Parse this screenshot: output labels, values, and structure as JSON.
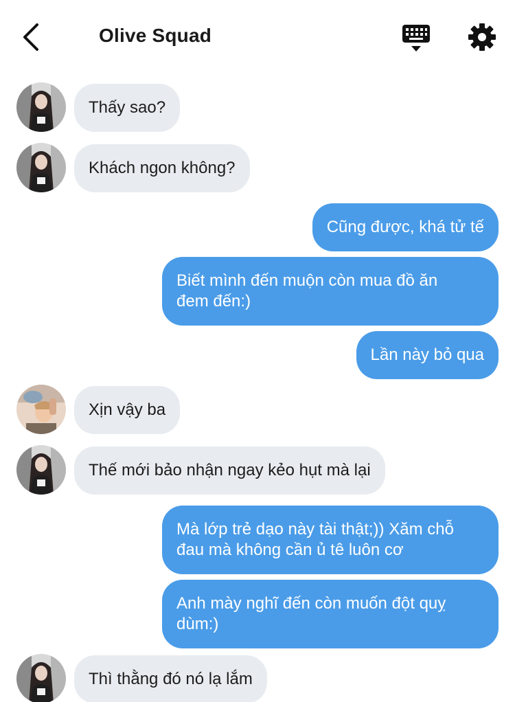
{
  "header": {
    "title": "Olive Squad",
    "back_icon": "chevron-left-icon",
    "keyboard_icon": "keyboard-icon",
    "settings_icon": "gear-icon"
  },
  "colors": {
    "outgoing_bubble": "#4a9ce8",
    "incoming_bubble": "#e8ecf0",
    "background": "#ffffff"
  },
  "messages": [
    {
      "direction": "in",
      "avatar": "member-a",
      "text": "Thấy sao?"
    },
    {
      "direction": "in",
      "avatar": "member-a",
      "text": "Khách ngon không?"
    },
    {
      "direction": "out",
      "text": "Cũng được, khá tử tế"
    },
    {
      "direction": "out",
      "lines": [
        "Biết mình đến muộn còn mua đồ ăn",
        "đem đến:)"
      ]
    },
    {
      "direction": "out",
      "text": "Lần này bỏ qua"
    },
    {
      "direction": "in",
      "avatar": "member-b",
      "text": "Xịn vậy ba"
    },
    {
      "direction": "in",
      "avatar": "member-a",
      "text": "Thế mới bảo nhận ngay kẻo hụt mà lại"
    },
    {
      "direction": "out",
      "lines": [
        "Mà lớp trẻ dạo này tài thật;)) Xăm chỗ",
        "đau mà không cần ủ tê luôn cơ"
      ]
    },
    {
      "direction": "out",
      "lines": [
        "Anh mày nghĩ đến còn muốn đột quỵ",
        "dùm:)"
      ]
    },
    {
      "direction": "in",
      "avatar": "member-a",
      "text": "Thì thằng đó nó lạ lắm"
    }
  ]
}
